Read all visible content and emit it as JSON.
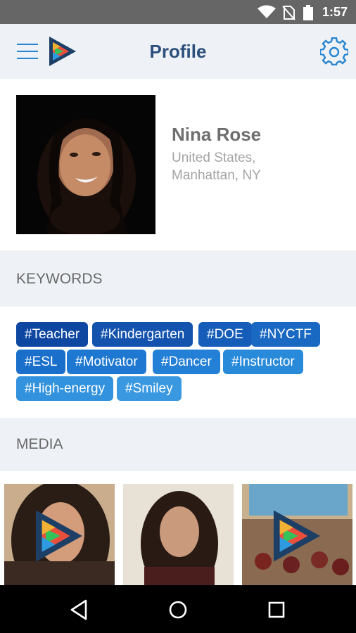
{
  "status_bar": {
    "time": "1:57",
    "icons": [
      "wifi-icon",
      "no-sim-icon",
      "battery-icon"
    ]
  },
  "app_bar": {
    "title": "Profile",
    "menu_icon": "hamburger-icon",
    "settings_icon": "gear-icon"
  },
  "profile": {
    "name": "Nina Rose",
    "location_line1": "United States,",
    "location_line2": "Manhattan, NY"
  },
  "keywords": {
    "header": "KEYWORDS",
    "tags": [
      {
        "label": "#Teacher",
        "color": "#0d47a1"
      },
      {
        "label": "#Kindergarten",
        "color": "#1352ad"
      },
      {
        "label": "#DOE",
        "color": "#155db8"
      },
      {
        "label": "#NYCTF",
        "color": "#1968c2"
      },
      {
        "label": "#ESL",
        "color": "#1a6fcb"
      },
      {
        "label": "#Motivator",
        "color": "#1e78d1"
      },
      {
        "label": "#Dancer",
        "color": "#2380d6"
      },
      {
        "label": "#Instructor",
        "color": "#2a8ada"
      },
      {
        "label": "#High-energy",
        "color": "#3292de"
      },
      {
        "label": "#Smiley",
        "color": "#3a98e0"
      }
    ]
  },
  "media": {
    "header": "MEDIA",
    "items": [
      {
        "type": "video",
        "has_play_badge": true
      },
      {
        "type": "photo",
        "has_play_badge": false
      },
      {
        "type": "video",
        "has_play_badge": true
      }
    ]
  },
  "nav_bar": {
    "buttons": [
      "back-icon",
      "home-icon",
      "recents-icon"
    ]
  }
}
